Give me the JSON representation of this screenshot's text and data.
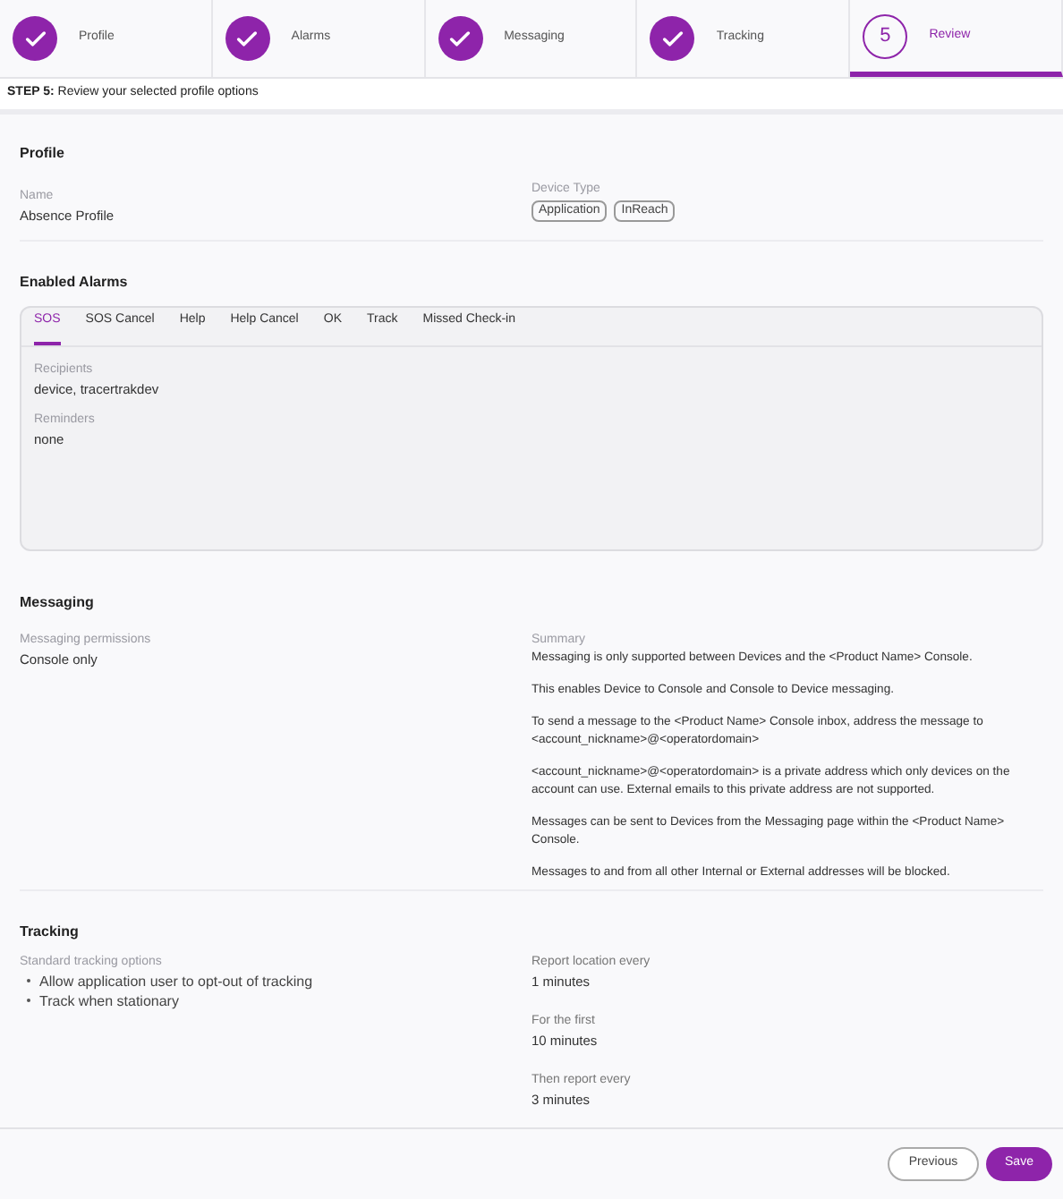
{
  "steps": [
    {
      "label": "Profile",
      "done": true,
      "selected": false
    },
    {
      "label": "Alarms",
      "done": true,
      "selected": false
    },
    {
      "label": "Messaging",
      "done": true,
      "selected": false
    },
    {
      "label": "Tracking",
      "done": true,
      "selected": false
    },
    {
      "label": "Review",
      "done": false,
      "number": "5",
      "selected": true
    }
  ],
  "step_caption": "**STEP 5:** Review your selected profile options",
  "profile": {
    "title": "Profile",
    "name_label": "Name",
    "name_value": "Absence Profile",
    "device_type_label": "Device Type",
    "device_types": [
      "Application",
      "InReach"
    ]
  },
  "alarms": {
    "title": "Enabled Alarms",
    "tabs": [
      {
        "label": "SOS",
        "selected": true
      },
      {
        "label": "SOS Cancel",
        "selected": false
      },
      {
        "label": "Help",
        "selected": false
      },
      {
        "label": "Help Cancel",
        "selected": false
      },
      {
        "label": "OK",
        "selected": false
      },
      {
        "label": "Track",
        "selected": false
      },
      {
        "label": "Missed Check-in",
        "selected": false
      }
    ],
    "fields": [
      {
        "label": "Recipients",
        "value": "device, tracertrakdev"
      },
      {
        "label": "Reminders",
        "value": "none"
      }
    ]
  },
  "messaging": {
    "title": "Messaging",
    "permissions_label": "Messaging permissions",
    "permissions_value": "Console only",
    "summary_label": "Summary",
    "summary": [
      "Messaging is only supported between Devices and the <Product Name> Console.",
      "This enables Device to Console and Console to Device messaging.",
      "To send a message to the <Product Name> Console inbox, address the message to <account_nickname>@<operatordomain>",
      "<account_nickname>@<operatordomain> is a private address which only devices on the account can use. External emails to this private address are not supported.",
      "Messages can be sent to Devices from the Messaging page within the <Product Name> Console.",
      "Messages to and from all other Internal or External addresses will be blocked."
    ]
  },
  "tracking": {
    "title": "Tracking",
    "options_label": "Standard tracking options",
    "options": [
      "Allow application user to opt-out of tracking",
      "Track when stationary"
    ],
    "settings": [
      {
        "label": "Report location every",
        "value": "1 minutes"
      },
      {
        "label": "For the first",
        "value": "10 minutes"
      },
      {
        "label": "Then report every",
        "value": "3 minutes"
      }
    ]
  },
  "footer": {
    "previous": "Previous",
    "save": "Save"
  }
}
